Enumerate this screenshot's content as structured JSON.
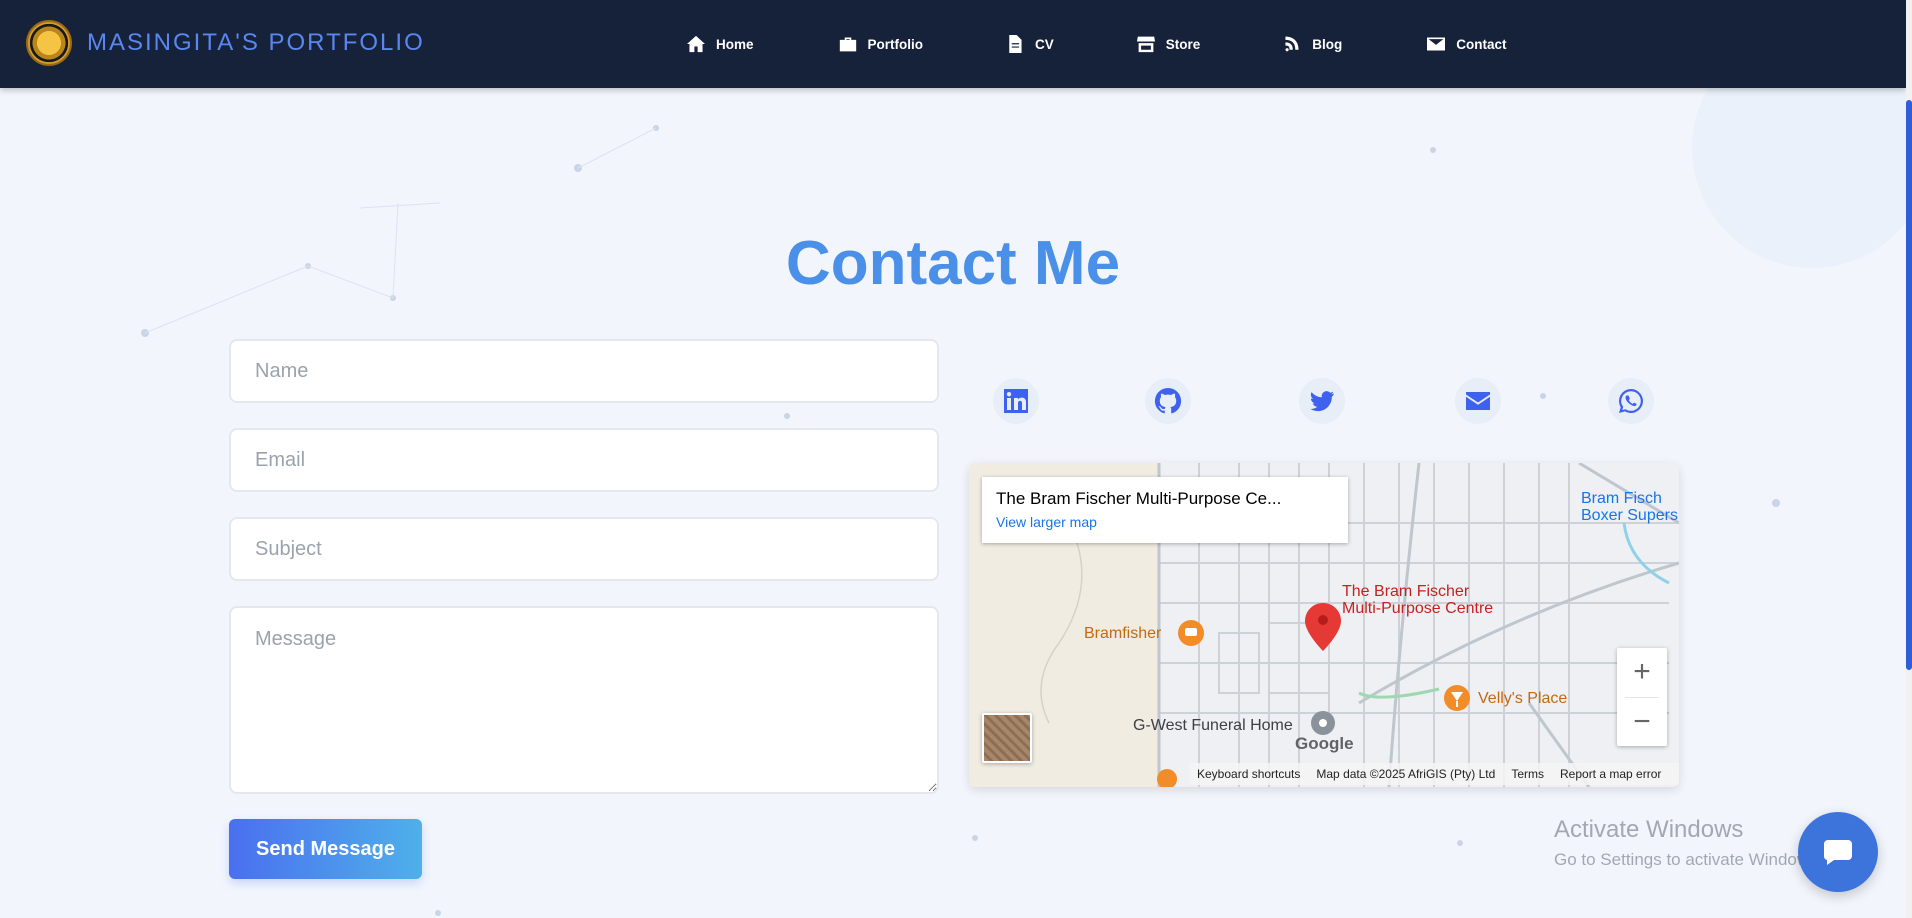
{
  "brand": {
    "name": "MASINGITA'S PORTFOLIO"
  },
  "nav": [
    {
      "label": "Home",
      "icon": "home-icon"
    },
    {
      "label": "Portfolio",
      "icon": "briefcase-icon"
    },
    {
      "label": "CV",
      "icon": "file-icon"
    },
    {
      "label": "Store",
      "icon": "store-icon"
    },
    {
      "label": "Blog",
      "icon": "blog-icon"
    },
    {
      "label": "Contact",
      "icon": "envelope-icon"
    }
  ],
  "page": {
    "title": "Contact Me"
  },
  "form": {
    "name_placeholder": "Name",
    "email_placeholder": "Email",
    "subject_placeholder": "Subject",
    "message_placeholder": "Message",
    "send_label": "Send Message"
  },
  "social": [
    {
      "icon": "linkedin-icon"
    },
    {
      "icon": "github-icon"
    },
    {
      "icon": "twitter-icon"
    },
    {
      "icon": "email-icon"
    },
    {
      "icon": "whatsapp-icon"
    }
  ],
  "map": {
    "card_title": "The Bram Fischer Multi-Purpose Ce...",
    "card_link": "View larger map",
    "place_line1": "The Bram Fischer",
    "place_line2": "Multi-Purpose Centre",
    "poi_bramfisher": "Bramfisher",
    "poi_velly": "Velly's Place",
    "poi_gwest": "G-West Funeral Home",
    "poi_bram2_line1": "Bram Fisch",
    "poi_bram2_line2": "Boxer Supers",
    "google": "Google",
    "zoom_in": "+",
    "zoom_out": "−",
    "footer": {
      "shortcuts": "Keyboard shortcuts",
      "data": "Map data ©2025 AfriGIS (Pty) Ltd",
      "terms": "Terms",
      "report": "Report a map error"
    }
  },
  "watermark": {
    "line1": "Activate Windows",
    "line2": "Go to Settings to activate Windows."
  },
  "colors": {
    "navbar": "#16223a",
    "accent": "#4a8fe8",
    "brand_text": "#5a86f0",
    "social_icon": "#3f62ee"
  }
}
